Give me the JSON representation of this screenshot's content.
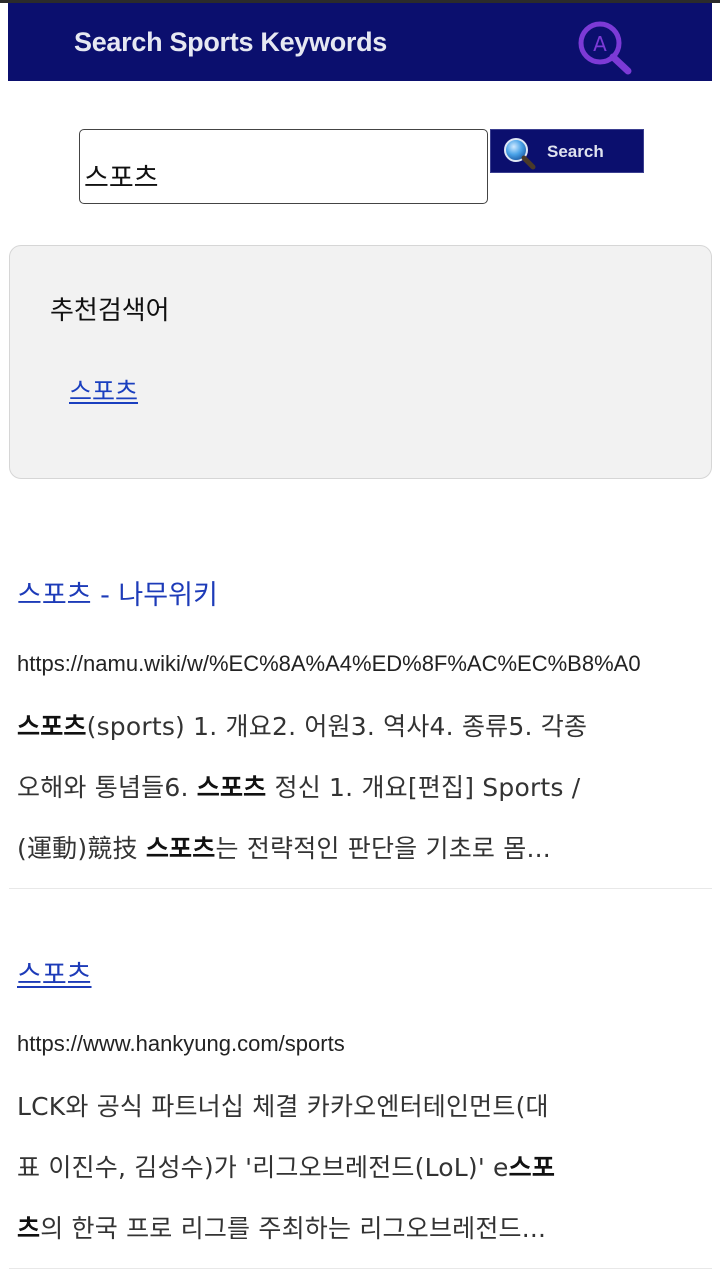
{
  "header": {
    "title": "Search Sports Keywords",
    "logo_icon": "magnifier-a-logo-icon",
    "logo_letter": "A",
    "colors": {
      "bar": "#0b0f6e",
      "logo": "#7c3ad6"
    }
  },
  "search": {
    "query": "스포츠",
    "button_label": "Search",
    "button_icon": "search-icon"
  },
  "recommendations": {
    "title": "추천검색어",
    "items": [
      "스포츠"
    ]
  },
  "results": [
    {
      "title": "스포츠 - 나무위키",
      "url": "https://namu.wiki/w/%EC%8A%A4%ED%8F%AC%EC%B8%A0",
      "desc_lines": [
        [
          "",
          "스포츠",
          "(sports) 1. 개요2. 어원3. 역사4. 종류5. 각종"
        ],
        [
          "오해와 통념들6. ",
          "스포츠",
          " 정신 1. 개요[편집] Sports /"
        ],
        [
          "(運動)競技 ",
          "스포츠",
          "는 전략적인 판단을 기초로 몸..."
        ]
      ]
    },
    {
      "title": "스포츠",
      "url": "https://www.hankyung.com/sports",
      "desc_lines": [
        [
          "LCK와 공식 파트너십 체결 카카오엔터테인먼트(대",
          "",
          ""
        ],
        [
          "표 이진수, 김성수)가 '리그오브레전드(LoL)' e",
          "스포",
          ""
        ],
        [
          "",
          "츠",
          "의 한국 프로 리그를 주최하는 리그오브레전드..."
        ]
      ]
    }
  ]
}
